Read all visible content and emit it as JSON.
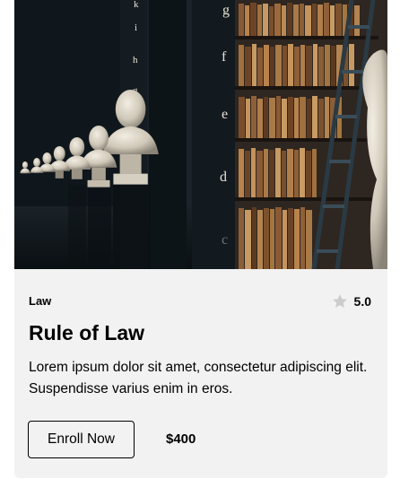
{
  "card": {
    "category": "Law",
    "rating": "5.0",
    "title": "Rule of Law",
    "description": "Lorem ipsum dolor sit amet, consectetur adipiscing elit. Suspendisse varius enim in eros.",
    "enroll_label": "Enroll Now",
    "price": "$400",
    "image_alt": "Library with marble busts and bookshelves",
    "icons": {
      "rating": "star-icon"
    },
    "colors": {
      "card_bg": "#f2f2f2",
      "star": "#cccccc"
    }
  }
}
